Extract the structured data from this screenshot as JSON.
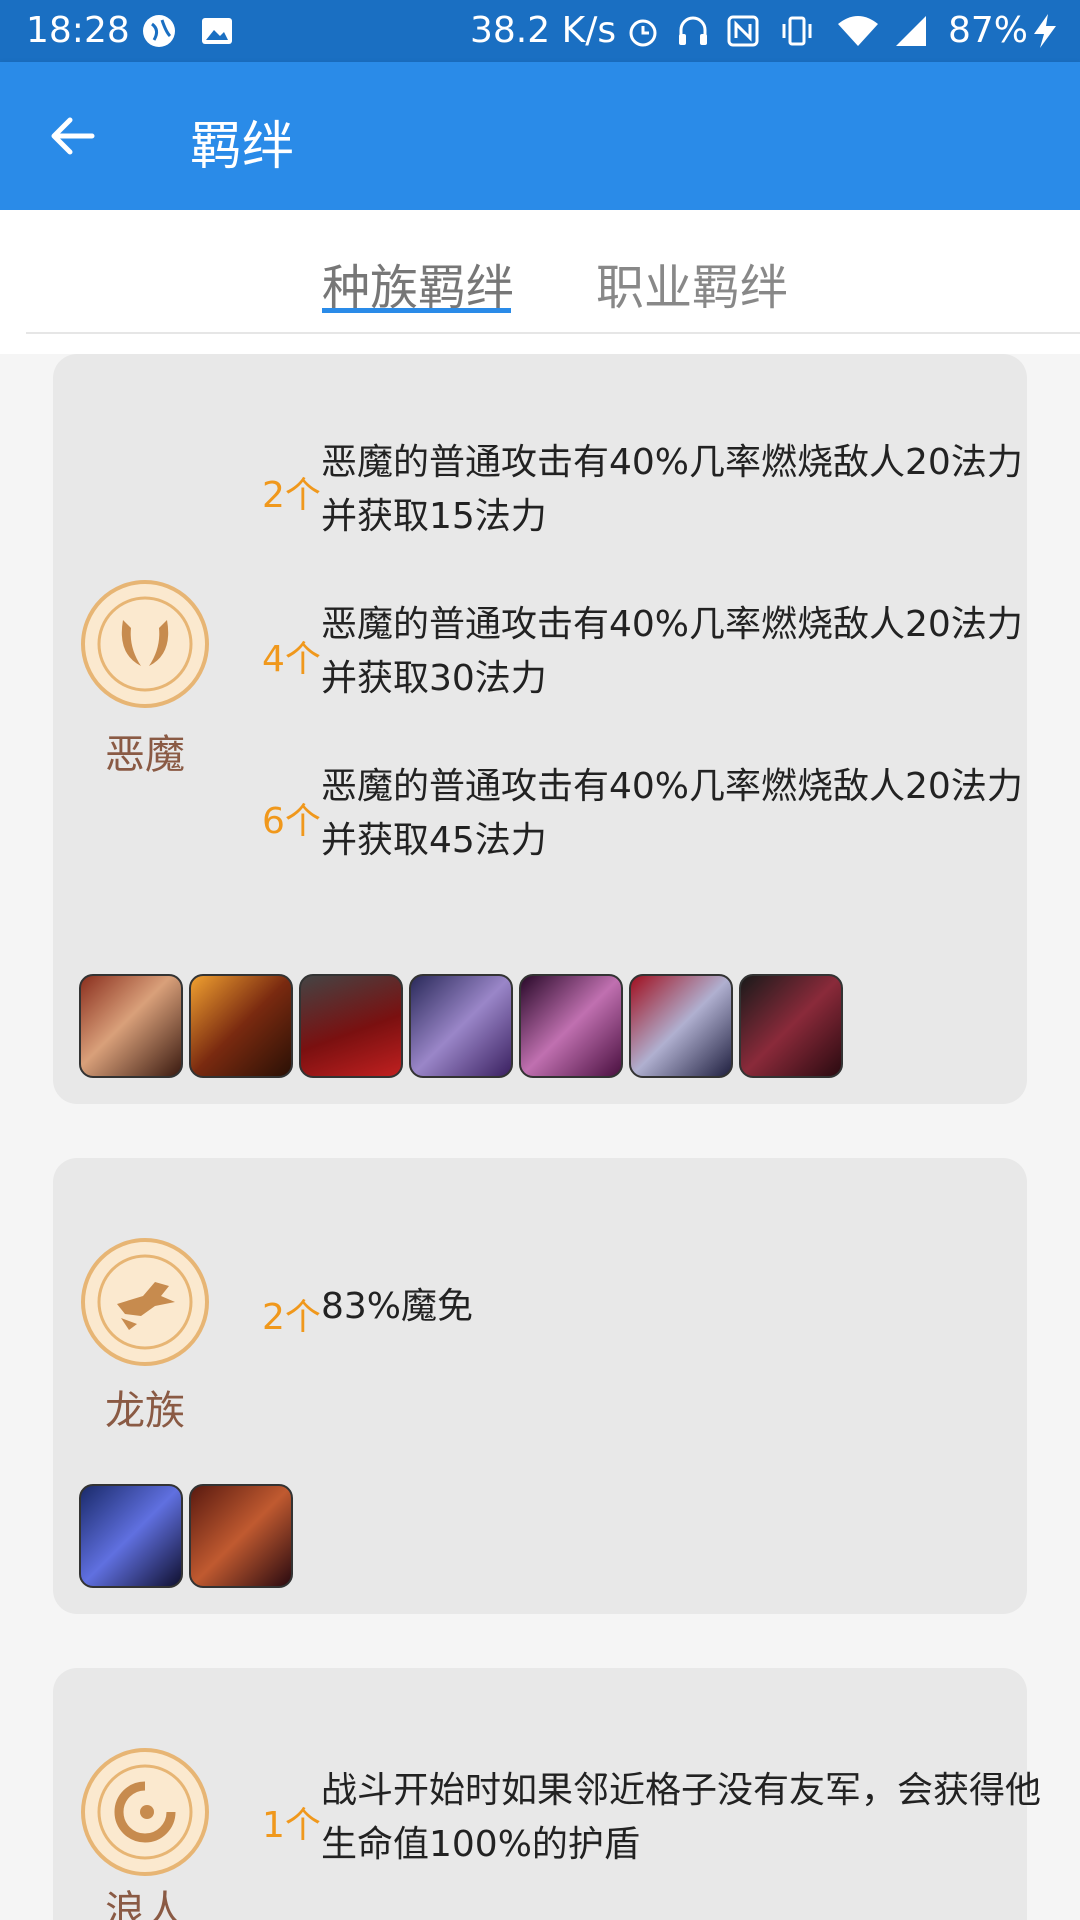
{
  "status_bar": {
    "time": "18:28",
    "network_speed": "38.2 K/s",
    "battery": "87%",
    "icons": [
      "location-icon",
      "image-icon",
      "alarm-icon",
      "headset-icon",
      "nfc-icon",
      "vibrate-icon",
      "wifi-icon",
      "signal-icon",
      "battery-charging-icon"
    ]
  },
  "app_bar": {
    "title": "羁绊",
    "back_icon": "arrow-left-icon"
  },
  "tabs": [
    {
      "label": "种族羁绊",
      "active": true
    },
    {
      "label": "职业羁绊",
      "active": false
    }
  ],
  "races": [
    {
      "name": "恶魔",
      "icon": "demon-horns-icon",
      "bonuses": [
        {
          "count": "2个",
          "text": "恶魔的普通攻击有40%几率燃烧敌人20法力并获取15法力"
        },
        {
          "count": "4个",
          "text": "恶魔的普通攻击有40%几率燃烧敌人20法力并获取30法力"
        },
        {
          "count": "6个",
          "text": "恶魔的普通攻击有40%几率燃烧敌人20法力并获取45法力"
        }
      ],
      "champions": [
        "champion-portrait-1",
        "champion-portrait-2",
        "champion-portrait-3",
        "champion-portrait-4",
        "champion-portrait-5",
        "champion-portrait-6",
        "champion-portrait-7"
      ]
    },
    {
      "name": "龙族",
      "icon": "dragon-icon",
      "bonuses": [
        {
          "count": "2个",
          "text": "83%魔免"
        }
      ],
      "champions": [
        "champion-portrait-1",
        "champion-portrait-2"
      ]
    },
    {
      "name": "浪人",
      "icon": "ronin-swirl-icon",
      "bonuses": [
        {
          "count": "1个",
          "text": "战斗开始时如果邻近格子没有友军，会获得他生命值100%的护盾"
        }
      ],
      "champions": []
    }
  ],
  "colors": {
    "status_bar": "#1a6fc2",
    "app_bar": "#2a8be8",
    "tab_indicator": "#2a8be8",
    "card_bg": "#e8e8e8",
    "count_text": "#f0981c",
    "race_name": "#8a5a44",
    "emblem_border": "#e7b574",
    "emblem_fill": "#fbe9cf"
  }
}
